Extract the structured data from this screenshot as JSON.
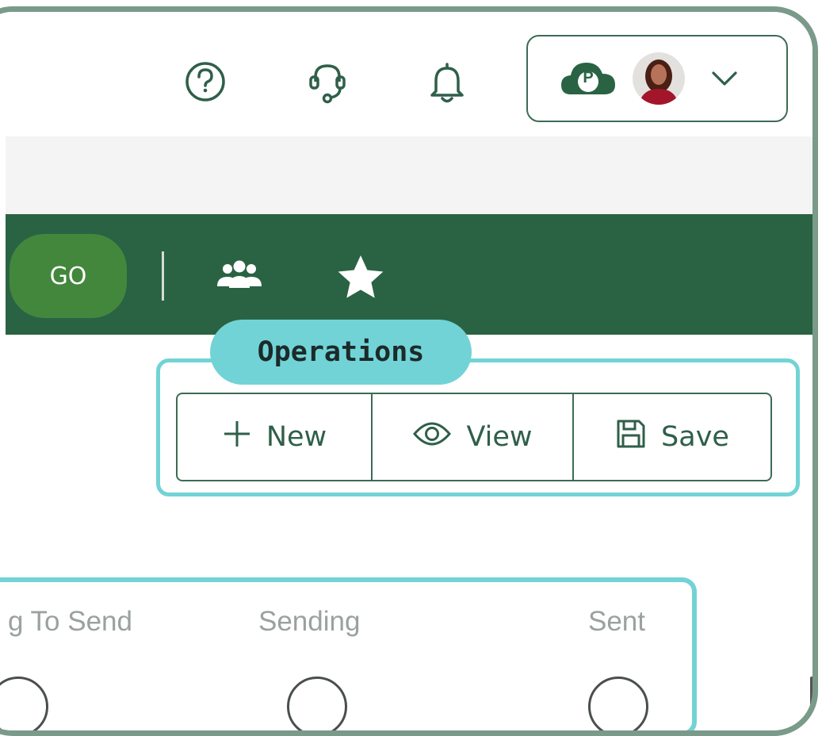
{
  "header": {
    "icons": [
      "help-circle-icon",
      "headset-icon",
      "bell-icon"
    ],
    "account": {
      "badge_letter": "P",
      "icons": [
        "cloud-badge-icon",
        "avatar",
        "chevron-down-icon"
      ]
    }
  },
  "toolbar": {
    "go_label": "GO",
    "icons": [
      "group-icon",
      "star-icon"
    ]
  },
  "operations": {
    "title": "Operations",
    "buttons": [
      {
        "label": "New",
        "icon": "plus-icon"
      },
      {
        "label": "View",
        "icon": "eye-icon"
      },
      {
        "label": "Save",
        "icon": "floppy-disk-icon"
      }
    ]
  },
  "status": {
    "steps": [
      "g To Send",
      "Sending",
      "Sent"
    ]
  },
  "colors": {
    "brand_green": "#2a6343",
    "go_green": "#43873c",
    "accent_teal": "#72d3d6",
    "icon_green": "#2f5f4a"
  }
}
